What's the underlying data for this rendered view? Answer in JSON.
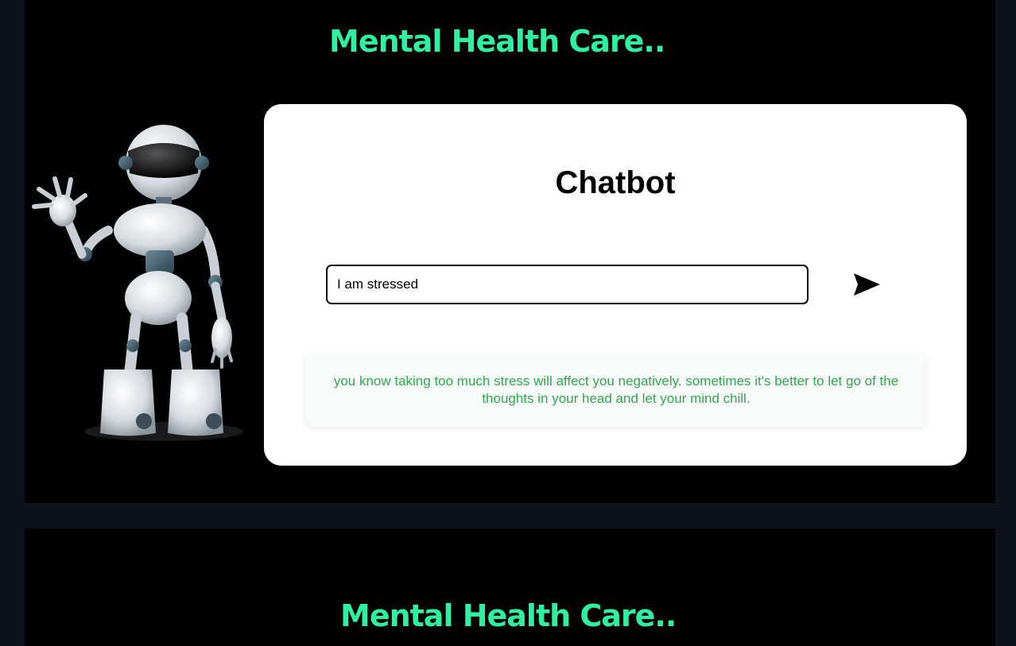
{
  "site_title": "Mental Health Care..",
  "chatbot": {
    "heading": "Chatbot",
    "input_value": "I am stressed",
    "response": "you know taking too much stress will affect you negatively. sometimes it's better to let go of the thoughts in your head and let your mind chill."
  },
  "icons": {
    "send": "send-icon",
    "robot": "robot-illustration"
  },
  "colors": {
    "title": "#2ff0a0",
    "response_text": "#2fa84f",
    "page_bg": "#0e131b",
    "panel_bg": "#000000",
    "card_bg": "#ffffff"
  }
}
